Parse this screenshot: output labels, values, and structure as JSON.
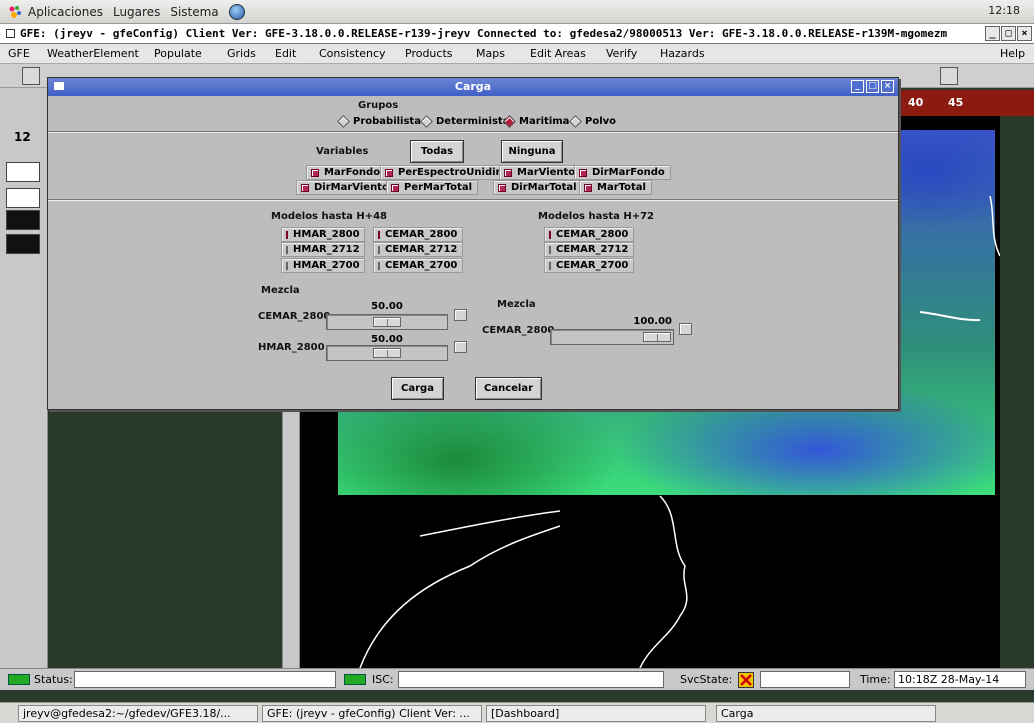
{
  "desktop": {
    "menus": [
      "Aplicaciones",
      "Lugares",
      "Sistema"
    ],
    "clock": "12:18"
  },
  "gfe": {
    "window_title": "GFE: (jreyv - gfeConfig) Client Ver: GFE-3.18.0.0.RELEASE-r139-jreyv Connected to: gfedesa2/98000513 Ver: GFE-3.18.0.0.RELEASE-r139M-mgomezm",
    "menus": [
      "GFE",
      "WeatherElement",
      "Populate",
      "Grids",
      "Edit",
      "Consistency",
      "Products",
      "Maps",
      "Edit Areas",
      "Verify",
      "Hazards",
      "Help"
    ],
    "left_time": "12",
    "scale_labels": [
      "40",
      "45"
    ]
  },
  "status": {
    "status_label": "Status:",
    "isc_label": "ISC:",
    "svcstate_label": "SvcState:",
    "time_label": "Time:",
    "time_value": "10:18Z 28-May-14"
  },
  "taskbar": {
    "tasks": [
      "jreyv@gfedesa2:~/gfedev/GFE3.18/...",
      "GFE: (jreyv - gfeConfig) Client Ver: ...",
      "[Dashboard]",
      "Carga"
    ]
  },
  "dialog": {
    "title": "Carga",
    "grupos_label": "Grupos",
    "grupos": [
      {
        "label": "Probabilista",
        "selected": false
      },
      {
        "label": "Determinista",
        "selected": false
      },
      {
        "label": "Maritima",
        "selected": true
      },
      {
        "label": "Polvo",
        "selected": false
      }
    ],
    "variables_label": "Variables",
    "todas_label": "Todas",
    "ninguna_label": "Ninguna",
    "variables": [
      {
        "label": "MarFondo",
        "checked": true
      },
      {
        "label": "PerEspectroUnidim",
        "checked": true
      },
      {
        "label": "MarViento",
        "checked": true
      },
      {
        "label": "DirMarFondo",
        "checked": true
      },
      {
        "label": "DirMarViento",
        "checked": true
      },
      {
        "label": "PerMarTotal",
        "checked": true
      },
      {
        "label": "DirMarTotal",
        "checked": true
      },
      {
        "label": "MarTotal",
        "checked": true
      }
    ],
    "h48_label": "Modelos hasta H+48",
    "h72_label": "Modelos hasta H+72",
    "h48_models": [
      {
        "label": "HMAR_2800",
        "checked": true
      },
      {
        "label": "CEMAR_2800",
        "checked": true
      },
      {
        "label": "HMAR_2712",
        "checked": false
      },
      {
        "label": "CEMAR_2712",
        "checked": false
      },
      {
        "label": "HMAR_2700",
        "checked": false
      },
      {
        "label": "CEMAR_2700",
        "checked": false
      }
    ],
    "h72_models": [
      {
        "label": "CEMAR_2800",
        "checked": true
      },
      {
        "label": "CEMAR_2712",
        "checked": false
      },
      {
        "label": "CEMAR_2700",
        "checked": false
      }
    ],
    "mezcla48_label": "Mezcla",
    "mezcla48": [
      {
        "label": "CEMAR_2800",
        "value_text": "50.00",
        "value": 50
      },
      {
        "label": "HMAR_2800",
        "value_text": "50.00",
        "value": 50
      }
    ],
    "mezcla72_label": "Mezcla",
    "mezcla72": [
      {
        "label": "CEMAR_2800",
        "value_text": "100.00",
        "value": 100
      }
    ],
    "carga_button": "Carga",
    "cancelar_button": "Cancelar"
  }
}
